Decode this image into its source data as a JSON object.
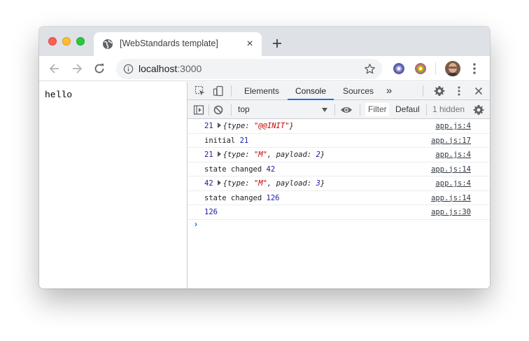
{
  "browser": {
    "tab_title": "[WebStandards template]",
    "tab_close": "×",
    "url_host": "localhost",
    "url_port": ":3000"
  },
  "page": {
    "body_text": "hello"
  },
  "devtools": {
    "tabs": [
      {
        "label": "Elements",
        "active": false
      },
      {
        "label": "Console",
        "active": true
      },
      {
        "label": "Sources",
        "active": false
      }
    ],
    "more_tabs": "»",
    "context": "top",
    "filter_placeholder": "Filter",
    "levels": "Defaul",
    "hidden": "1 hidden",
    "prompt": "›",
    "console": [
      {
        "n": "21",
        "obj": true,
        "type": "\"@@INIT\"",
        "payload": null,
        "src": "app.js:4"
      },
      {
        "text": "initial",
        "n": "21",
        "src": "app.js:17"
      },
      {
        "n": "21",
        "obj": true,
        "type": "\"M\"",
        "payload": "2",
        "src": "app.js:4"
      },
      {
        "text": "state changed",
        "n": "42",
        "src": "app.js:14"
      },
      {
        "n": "42",
        "obj": true,
        "type": "\"M\"",
        "payload": "3",
        "src": "app.js:4"
      },
      {
        "text": "state changed",
        "n": "126",
        "src": "app.js:14"
      },
      {
        "n": "126",
        "src": "app.js:30"
      }
    ],
    "labels": {
      "type": "type",
      "payload": "payload"
    }
  },
  "colors": {
    "accent": "#1a73e8",
    "number": "#1a1aa6",
    "string": "#c80000"
  }
}
